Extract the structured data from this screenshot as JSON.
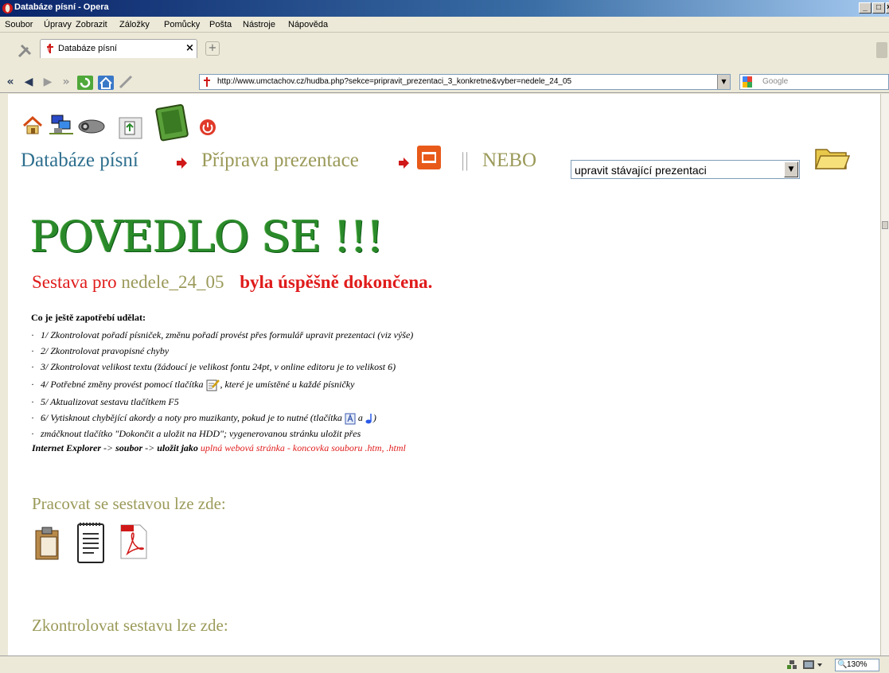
{
  "window": {
    "title": "Databáze písní - Opera",
    "minimize": "_",
    "maximize": "□",
    "close": "×"
  },
  "menu": [
    "Soubor",
    "Úpravy",
    "Zobrazit",
    "Záložky",
    "Pomůcky",
    "Pošta",
    "Nástroje",
    "Nápověda"
  ],
  "tab": {
    "label": "Databáze písní",
    "close": "×",
    "new_tab": "+"
  },
  "address": {
    "url": "http://www.umctachov.cz/hudba.php?sekce=pripravit_prezentaci_3_konkretne&vyber=nedele_24_05"
  },
  "search": {
    "placeholder": "Google"
  },
  "page": {
    "breadcrumb": {
      "db": "Databáze písní",
      "prep": "Příprava prezentace",
      "sep": "||",
      "or": "NEBO"
    },
    "select_value": "upravit stávající prezentaci",
    "big_title": "POVEDLO SE !!!",
    "subtitle": {
      "pre": "Sestava pro",
      "name": "nedele_24_05",
      "post": "byla úspěšně dokončena."
    },
    "todo_head": "Co je ještě zapotřebí udělat:",
    "todo": [
      "1/ Zkontrolovat pořadí písniček, změnu pořadí provést přes formulář upravit prezentaci (viz výše)",
      "2/ Zkontrolovat pravopisné chyby",
      "3/ Zkontrolovat velikost textu (žádoucí je velikost fontu 24pt, v online editoru je to velikost 6)",
      "5/ Aktualizovat sestavu tlačítkem F5",
      "zmáčknout tlačítko \"Dokončit a uložit na HDD\"; vygenerovanou stránku uložit přes"
    ],
    "todo4": {
      "pre": "4/ Potřebné změny provést pomocí tlačítka",
      "post": ", které je umístěné u každé písničky"
    },
    "todo6": {
      "pre": "6/ Vytisknout chybějící akordy a noty pro muzikanty, pokud je to nutné (tlačítka",
      "mid": "a",
      "post": ")"
    },
    "save_line": {
      "ie": "Internet Explorer",
      "arrow1": "->",
      "soubor": "soubor",
      "arrow2": "->",
      "ulozit": "uložit jako",
      "rest": "uplná webová stránka - koncovka souboru .htm, .html"
    },
    "section1": "Pracovat se sestavou lze zde:",
    "section2": "Zkontrolovat sestavu lze zde:"
  },
  "status": {
    "zoom": "130%"
  },
  "colors": {
    "title_red": "#e01b1b",
    "olive": "#9b9a5a",
    "link_blue": "#2e6f8e",
    "green": "#2a8a2a"
  }
}
